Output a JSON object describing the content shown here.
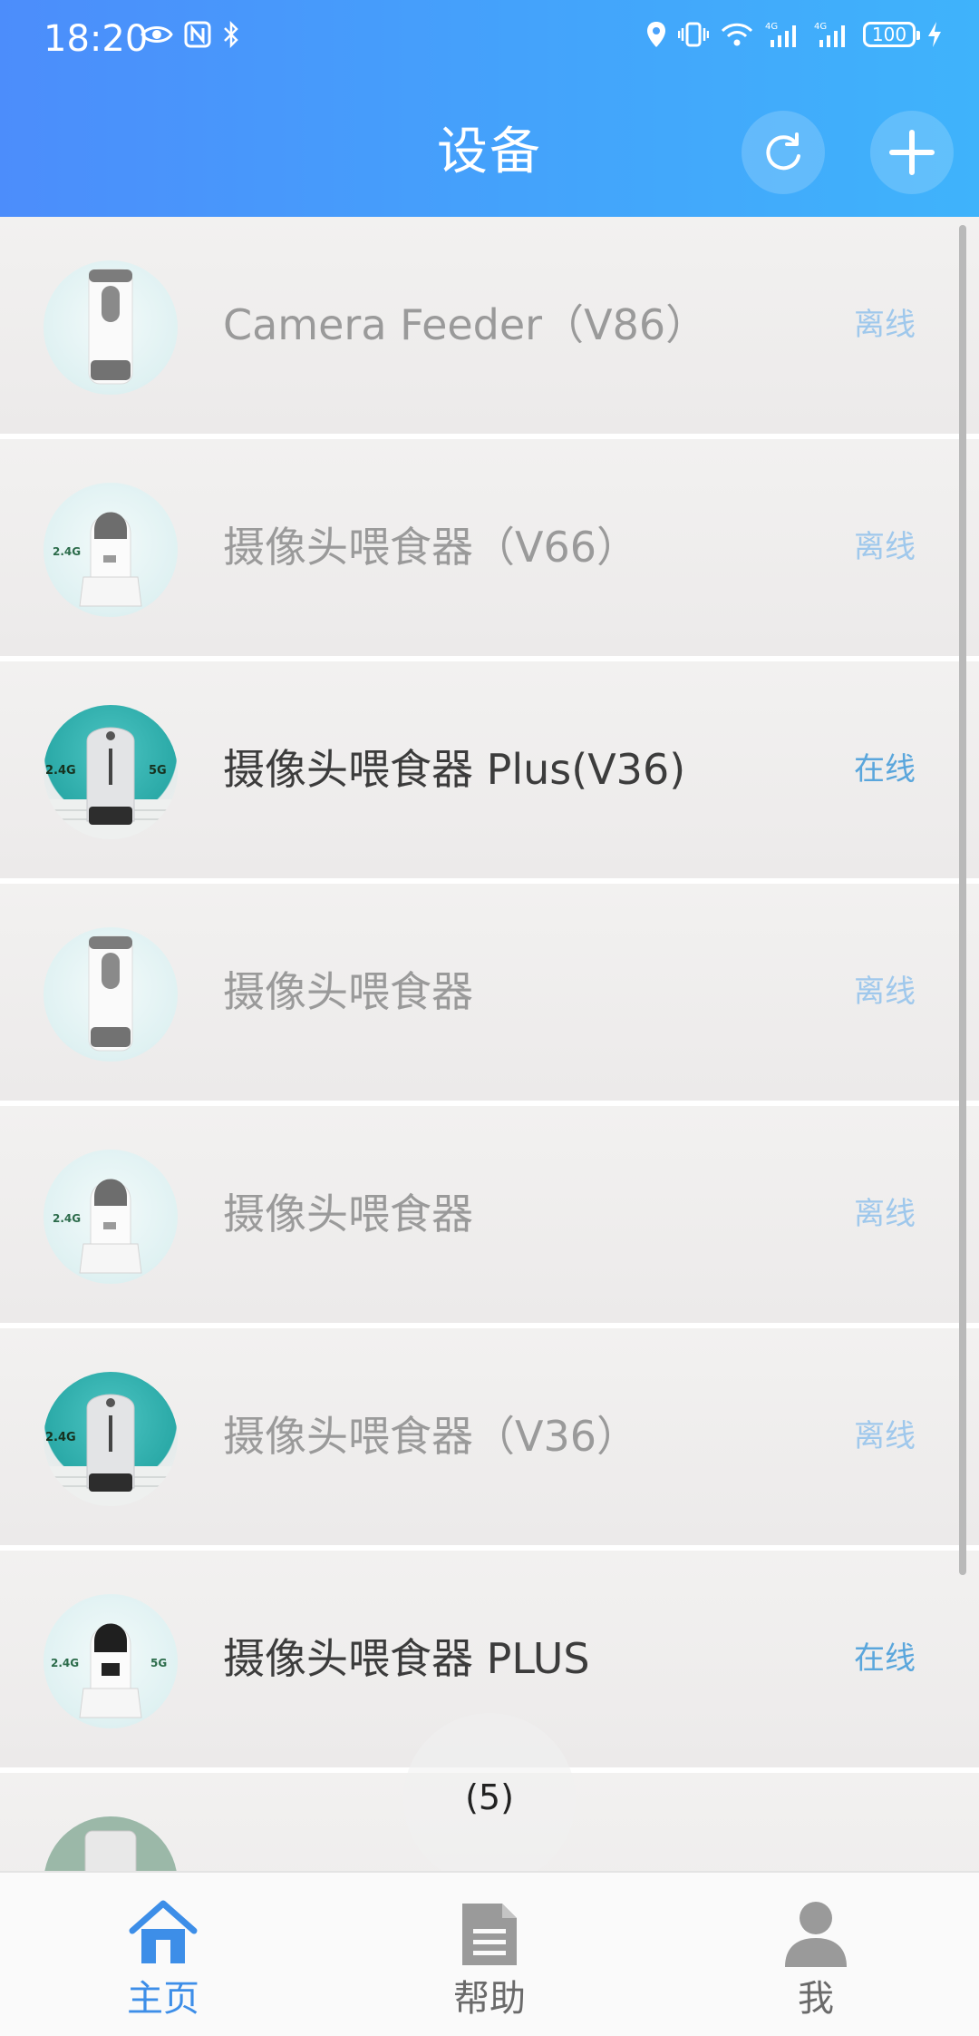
{
  "status_bar": {
    "time": "18:20",
    "battery": "100",
    "network_1": "4G",
    "network_2": "4G"
  },
  "header": {
    "title": "设备"
  },
  "devices": [
    {
      "name": "Camera Feeder（V86）",
      "status": "离线",
      "online": false
    },
    {
      "name": "摄像头喂食器（V66）",
      "status": "离线",
      "online": false
    },
    {
      "name": "摄像头喂食器 Plus(V36)",
      "status": "在线",
      "online": true
    },
    {
      "name": "摄像头喂食器",
      "status": "离线",
      "online": false
    },
    {
      "name": "摄像头喂食器",
      "status": "离线",
      "online": false
    },
    {
      "name": "摄像头喂食器（V36）",
      "status": "离线",
      "online": false
    },
    {
      "name": "摄像头喂食器 PLUS",
      "status": "在线",
      "online": true
    }
  ],
  "thumb_badges": {
    "b24": "2.4G",
    "b5": "5G"
  },
  "page_indicator": "(5)",
  "bottom_nav": {
    "home": "主页",
    "help": "帮助",
    "me": "我"
  },
  "colors": {
    "header_gradient_start": "#4c8dfb",
    "header_gradient_end": "#3fb3fb",
    "online_status": "#5aa6dc",
    "offline_status": "#9fc8ec",
    "nav_active": "#3d8ee8"
  }
}
